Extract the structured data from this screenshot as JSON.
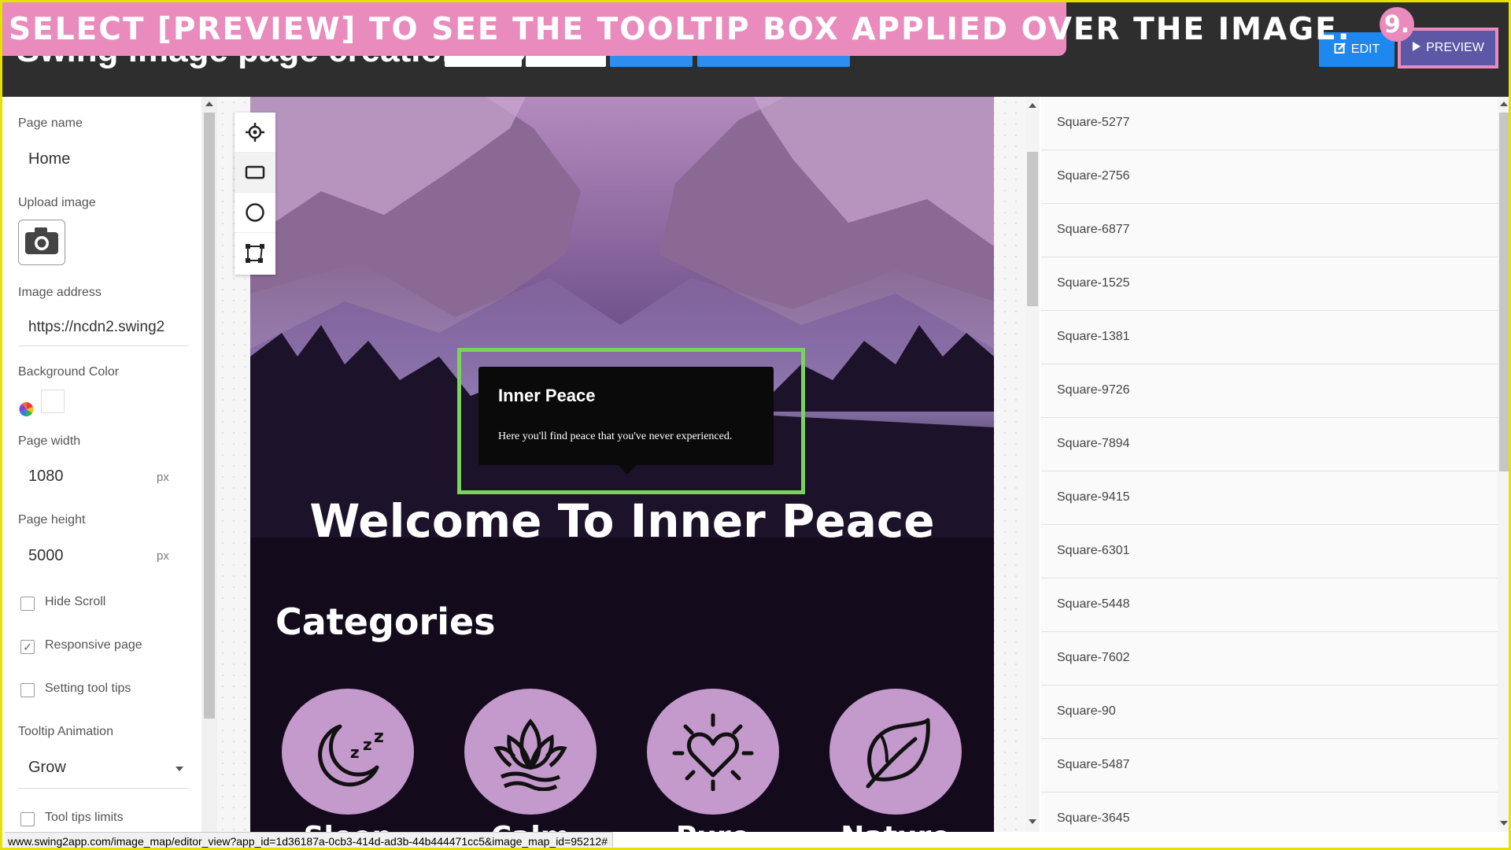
{
  "header": {
    "app_title": "Swing image page creation tool",
    "edit_label": "EDIT",
    "preview_label": "PREVIEW"
  },
  "annotation": {
    "banner_text": "SELECT [PREVIEW] TO SEE THE TOOLTIP BOX APPLIED OVER THE IMAGE.",
    "step_number": "9.",
    "highlight_color": "#e98bbd",
    "tooltip_highlight_color": "#7bd35d"
  },
  "settings": {
    "page_name_label": "Page name",
    "page_name_value": "Home",
    "upload_image_label": "Upload image",
    "image_address_label": "Image address",
    "image_address_value": "https://ncdn2.swing2",
    "background_color_label": "Background Color",
    "background_color_value": "#ffffff",
    "page_width_label": "Page width",
    "page_width_value": "1080",
    "page_width_unit": "px",
    "page_height_label": "Page height",
    "page_height_value": "5000",
    "page_height_unit": "px",
    "hide_scroll_label": "Hide Scroll",
    "hide_scroll_checked": false,
    "responsive_label": "Responsive page",
    "responsive_checked": true,
    "tooltips_label": "Setting tool tips",
    "tooltips_checked": false,
    "tooltip_animation_label": "Tooltip Animation",
    "tooltip_animation_value": "Grow",
    "tooltip_limits_label": "Tool tips limits",
    "tooltip_limits_checked": false
  },
  "tools": [
    "crosshair-icon",
    "rectangle-icon",
    "circle-icon",
    "polygon-icon"
  ],
  "canvas": {
    "tooltip_title": "Inner Peace",
    "tooltip_text": "Here you'll find peace that you've never experienced.",
    "welcome_heading": "Welcome To Inner Peace",
    "categories_heading": "Categories",
    "categories": [
      {
        "label": "Sleep",
        "icon": "moon-sleep-icon"
      },
      {
        "label": "Calm",
        "icon": "lotus-icon"
      },
      {
        "label": "Pure",
        "icon": "heart-sun-icon"
      },
      {
        "label": "Nature",
        "icon": "leaf-icon"
      }
    ]
  },
  "layers": [
    "Square-5277",
    "Square-2756",
    "Square-6877",
    "Square-1525",
    "Square-1381",
    "Square-9726",
    "Square-7894",
    "Square-9415",
    "Square-6301",
    "Square-5448",
    "Square-7602",
    "Square-90",
    "Square-5487",
    "Square-3645"
  ],
  "status": {
    "url": "www.swing2app.com/image_map/editor_view?app_id=1d36187a-0cb3-414d-ad3b-44b444471cc5&image_map_id=95212#"
  }
}
